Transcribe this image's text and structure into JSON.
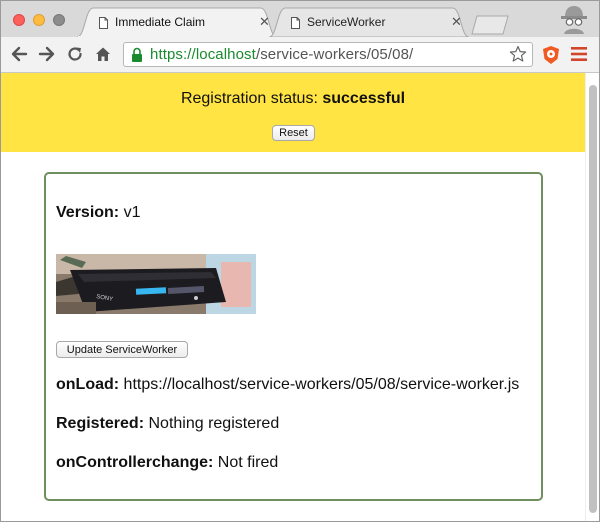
{
  "browser": {
    "tabs": [
      {
        "title": "Immediate Claim",
        "active": true
      },
      {
        "title": "ServiceWorker",
        "active": false
      }
    ],
    "url_host": "https://localhost",
    "url_path": "/service-workers/05/08/"
  },
  "page": {
    "status_label": "Registration status:",
    "status_value": "successful",
    "reset_label": "Reset",
    "version_label": "Version:",
    "version_value": "v1",
    "update_label": "Update ServiceWorker",
    "onload_label": "onLoad:",
    "onload_value": "https://localhost/service-workers/05/08/service-worker.js",
    "registered_label": "Registered:",
    "registered_value": "Nothing registered",
    "controllerchange_label": "onControllerchange:",
    "controllerchange_value": "Not fired"
  },
  "colors": {
    "status_background": "#ffe444",
    "card_border": "#6e8f5e",
    "url_secure": "#1a8a2f"
  },
  "icons": [
    "close-window-icon",
    "minimize-window-icon",
    "maximize-window-icon",
    "document-icon",
    "tab-close-icon",
    "incognito-icon",
    "back-arrow-icon",
    "forward-arrow-icon",
    "reload-icon",
    "home-icon",
    "lock-icon",
    "star-icon",
    "extension-icon",
    "menu-icon"
  ]
}
